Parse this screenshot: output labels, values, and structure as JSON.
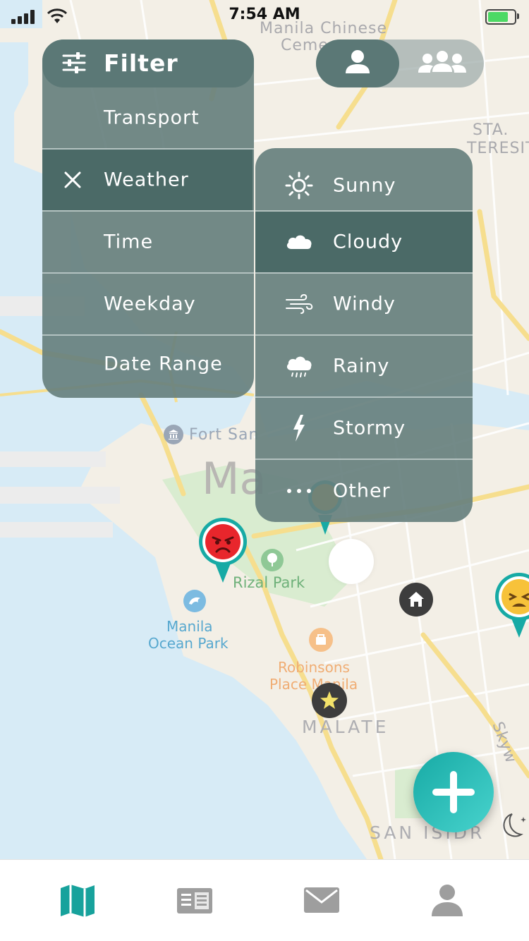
{
  "status_bar": {
    "time": "7:54 AM"
  },
  "map": {
    "labels": {
      "chinese_cemetery": "Manila Chinese",
      "chinese_cemetery_2": "Ceme",
      "sta_teresita": "STA.",
      "sta_teresita_2": "TERESIT",
      "fort_santiago": "Fort San",
      "city": "Ma",
      "rizal_park": "Rizal Park",
      "ocean_park": "Manila",
      "ocean_park_2": "Ocean Park",
      "robinsons": "Robinsons",
      "robinsons_2": "Place Manila",
      "malate": "MALATE",
      "san_isidro": "SAN ISIDR",
      "skyway": "Skyw"
    }
  },
  "filter": {
    "title": "Filter",
    "items": [
      {
        "label": "Transport",
        "active": false
      },
      {
        "label": "Weather",
        "active": true
      },
      {
        "label": "Time",
        "active": false
      },
      {
        "label": "Weekday",
        "active": false
      },
      {
        "label": "Date Range",
        "active": false
      }
    ]
  },
  "weather": {
    "items": [
      {
        "label": "Sunny",
        "icon": "sun-icon",
        "active": false
      },
      {
        "label": "Cloudy",
        "icon": "cloud-icon",
        "active": true
      },
      {
        "label": "Windy",
        "icon": "wind-icon",
        "active": false
      },
      {
        "label": "Rainy",
        "icon": "rain-icon",
        "active": false
      },
      {
        "label": "Stormy",
        "icon": "lightning-icon",
        "active": false
      },
      {
        "label": "Other",
        "icon": "more-dots-icon",
        "active": false
      }
    ]
  },
  "view_toggle": {
    "options": [
      "personal",
      "group"
    ],
    "selected": "personal"
  },
  "tabs": [
    {
      "name": "map",
      "icon": "map-icon",
      "selected": true
    },
    {
      "name": "feed",
      "icon": "newspaper-icon",
      "selected": false
    },
    {
      "name": "messages",
      "icon": "mail-icon",
      "selected": false
    },
    {
      "name": "profile",
      "icon": "person-icon",
      "selected": false
    }
  ],
  "colors": {
    "accent": "#17aaa5",
    "panel": "#67807e",
    "panel_active": "#4b6a67",
    "water": "#d8ecf7",
    "land": "#f3efe6",
    "road": "#f8e39a",
    "park": "#d9ecd0"
  }
}
